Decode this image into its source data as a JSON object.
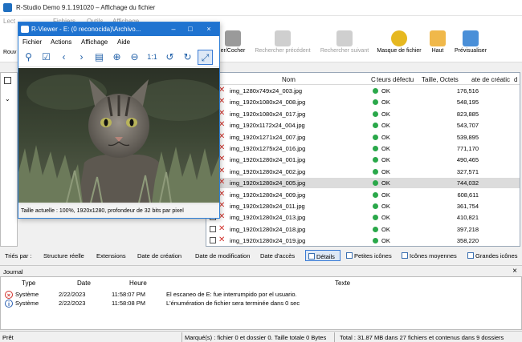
{
  "app": {
    "title": "R-Studio Demo 9.1.191020 – Affichage du fichier"
  },
  "menu": {
    "items": [
      "Lect",
      "Fichiers",
      "Outils",
      "Affichage"
    ]
  },
  "toolbar": {
    "rouv": "Rouv",
    "buttons": [
      {
        "id": "cocher",
        "label": "er/Cocher",
        "icon": "check-binoculars-icon",
        "enabled": true
      },
      {
        "id": "prev",
        "label": "Rechercher précédent",
        "icon": "binoculars-icon",
        "enabled": false
      },
      {
        "id": "next",
        "label": "Rechercher suivant",
        "icon": "binoculars-icon",
        "enabled": false
      },
      {
        "id": "mask",
        "label": "Masque de fichier",
        "icon": "mask-icon",
        "enabled": true
      },
      {
        "id": "up",
        "label": "Haut",
        "icon": "folder-up-icon",
        "enabled": true
      },
      {
        "id": "preview",
        "label": "Prévisualiser",
        "icon": "preview-icon",
        "enabled": true
      }
    ]
  },
  "filelist": {
    "columns": {
      "name": "Nom",
      "c": "C",
      "defect": "teurs défectu",
      "size": "Taille, Octets",
      "created": "ate de créatic",
      "d": "d"
    },
    "rows": [
      {
        "name": "img_1280x749x24_003.jpg",
        "status": "OK",
        "size": "176,516",
        "selected": false
      },
      {
        "name": "img_1920x1080x24_008.jpg",
        "status": "OK",
        "size": "548,195",
        "selected": false
      },
      {
        "name": "img_1920x1080x24_017.jpg",
        "status": "OK",
        "size": "823,885",
        "selected": false
      },
      {
        "name": "img_1920x1172x24_004.jpg",
        "status": "OK",
        "size": "543,707",
        "selected": false
      },
      {
        "name": "img_1920x1271x24_007.jpg",
        "status": "OK",
        "size": "539,895",
        "selected": false
      },
      {
        "name": "img_1920x1275x24_016.jpg",
        "status": "OK",
        "size": "771,170",
        "selected": false
      },
      {
        "name": "img_1920x1280x24_001.jpg",
        "status": "OK",
        "size": "490,465",
        "selected": false
      },
      {
        "name": "img_1920x1280x24_002.jpg",
        "status": "OK",
        "size": "327,571",
        "selected": false
      },
      {
        "name": "img_1920x1280x24_005.jpg",
        "status": "OK",
        "size": "744,032",
        "selected": true
      },
      {
        "name": "img_1920x1280x24_009.jpg",
        "status": "OK",
        "size": "608,611",
        "selected": false
      },
      {
        "name": "img_1920x1280x24_011.jpg",
        "status": "OK",
        "size": "361,754",
        "selected": false
      },
      {
        "name": "img_1920x1280x24_013.jpg",
        "status": "OK",
        "size": "410,821",
        "selected": false
      },
      {
        "name": "img_1920x1280x24_018.jpg",
        "status": "OK",
        "size": "397,218",
        "selected": false
      },
      {
        "name": "img_1920x1280x24_019.jpg",
        "status": "OK",
        "size": "358,220",
        "selected": false
      }
    ]
  },
  "sortbar": {
    "label": "Triés par :",
    "sorts": [
      "Structure réelle",
      "Extensions",
      "Date de création",
      "Date de modification",
      "Date d'accès"
    ],
    "views": [
      "Détails",
      "Petites icônes",
      "Icônes moyennes",
      "Grandes icônes"
    ]
  },
  "journal": {
    "title": "Journal",
    "columns": {
      "type": "Type",
      "date": "Date",
      "time": "Heure",
      "text": "Texte"
    },
    "rows": [
      {
        "level": "error",
        "type": "Système",
        "date": "2/22/2023",
        "time": "11:58:07 PM",
        "text": "El escaneo de E: fue interrumpido por el usuario."
      },
      {
        "level": "info",
        "type": "Système",
        "date": "2/22/2023",
        "time": "11:58:08 PM",
        "text": "L'énumération de fichier sera terminée dans 0 sec"
      }
    ]
  },
  "statusbar": {
    "ready": "Prêt",
    "marked": "Marqué(s) : fichier 0 et dossier 0. Taille totale 0 Bytes",
    "total": "Total : 31.87 MB dans 27 fichiers et contenus dans 9 dossiers"
  },
  "viewer": {
    "title": "R-Viewer - E: (0 reconocida)\\Archivo...",
    "menu": [
      "Fichier",
      "Actions",
      "Affichage",
      "Aide"
    ],
    "tools": [
      {
        "name": "pin-icon",
        "glyph": "⚲"
      },
      {
        "name": "checkbox-icon",
        "glyph": "☑"
      },
      {
        "name": "prev-icon",
        "glyph": "‹"
      },
      {
        "name": "next-icon",
        "glyph": "›"
      },
      {
        "name": "open-folder-icon",
        "glyph": "▤"
      },
      {
        "name": "zoom-in-icon",
        "glyph": "⊕"
      },
      {
        "name": "zoom-out-icon",
        "glyph": "⊖"
      },
      {
        "name": "actual-size-icon",
        "glyph": "1:1"
      },
      {
        "name": "rotate-left-icon",
        "glyph": "↺"
      },
      {
        "name": "rotate-right-icon",
        "glyph": "↻"
      },
      {
        "name": "fit-window-icon",
        "glyph": "⤢"
      }
    ],
    "status": "Taille actuelle : 100%, 1920x1280, profondeur de 32 bits par pixel"
  },
  "colors": {
    "accent": "#1f73d0",
    "ok": "#2aa84a",
    "error": "#d0302a"
  }
}
